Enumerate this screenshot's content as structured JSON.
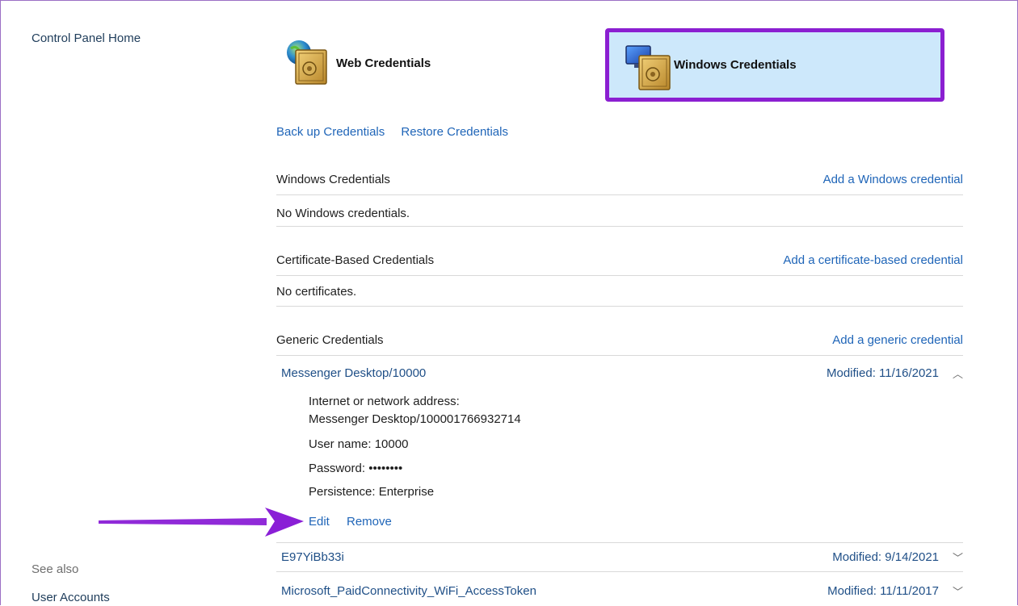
{
  "sidebar": {
    "home_link": "Control Panel Home",
    "see_also_label": "See also",
    "user_accounts_link": "User Accounts"
  },
  "tiles": {
    "web": {
      "label": "Web Credentials",
      "icon": "web-vault-icon"
    },
    "windows": {
      "label": "Windows Credentials",
      "icon": "windows-vault-icon",
      "selected": true
    }
  },
  "actions": {
    "backup": "Back up Credentials",
    "restore": "Restore Credentials"
  },
  "sections": {
    "windows": {
      "title": "Windows Credentials",
      "add_link": "Add a Windows credential",
      "empty_text": "No Windows credentials."
    },
    "certificate": {
      "title": "Certificate-Based Credentials",
      "add_link": "Add a certificate-based credential",
      "empty_text": "No certificates."
    },
    "generic": {
      "title": "Generic Credentials",
      "add_link": "Add a generic credential",
      "items": [
        {
          "name": "Messenger Desktop/10000",
          "modified": "Modified:  11/16/2021",
          "expanded": true,
          "chevron": "chevron-up-icon",
          "address_label": "Internet or network address:",
          "address_value": "Messenger Desktop/100001766932714",
          "username": "User name:  10000",
          "password": "Password:  ••••••••",
          "persistence": "Persistence:  Enterprise",
          "edit_label": "Edit",
          "remove_label": "Remove"
        },
        {
          "name": "E97YiBb33i",
          "modified": "Modified:  9/14/2021",
          "expanded": false,
          "chevron": "chevron-down-icon"
        },
        {
          "name": "Microsoft_PaidConnectivity_WiFi_AccessToken",
          "modified": "Modified:  11/11/2017",
          "expanded": false,
          "chevron": "chevron-down-icon"
        }
      ]
    }
  },
  "colors": {
    "highlight_border": "#8b1fd1",
    "highlight_fill": "#cde8fb",
    "link": "#1f65b8",
    "annotation_arrow": "#8a1fd6"
  }
}
